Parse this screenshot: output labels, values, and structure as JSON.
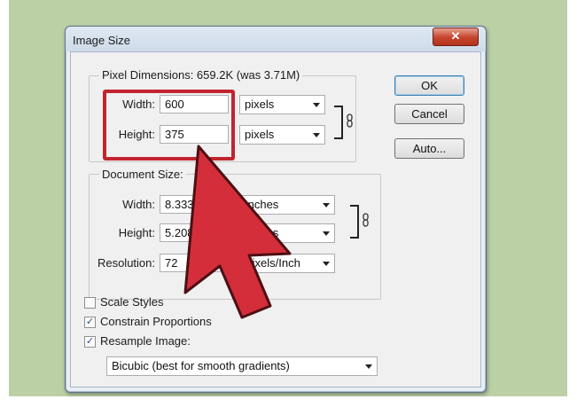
{
  "window": {
    "title": "Image Size",
    "close_glyph": "✕"
  },
  "buttons": {
    "ok": "OK",
    "cancel": "Cancel",
    "auto": "Auto..."
  },
  "pixel_dimensions": {
    "legend": "Pixel Dimensions:  659.2K (was 3.71M)",
    "width_label": "Width:",
    "width_value": "600",
    "width_unit": "pixels",
    "height_label": "Height:",
    "height_value": "375",
    "height_unit": "pixels"
  },
  "document_size": {
    "legend": "Document Size:",
    "width_label": "Width:",
    "width_value": "8.333",
    "width_unit": "Inches",
    "height_label": "Height:",
    "height_value": "5.208",
    "height_unit": "Inches",
    "resolution_label": "Resolution:",
    "resolution_value": "72",
    "resolution_unit": "Pixels/Inch"
  },
  "options": {
    "scale_styles": {
      "label": "Scale Styles",
      "checked": false
    },
    "constrain_proportions": {
      "label": "Constrain Proportions",
      "checked": true
    },
    "resample_image": {
      "label": "Resample Image:",
      "checked": true
    },
    "resample_method": "Bicubic (best for smooth gradients)"
  },
  "colors": {
    "highlight": "#c2252f",
    "arrow_fill": "#d42e3b",
    "background": "#bcd0a6"
  },
  "check_glyph": "✓"
}
